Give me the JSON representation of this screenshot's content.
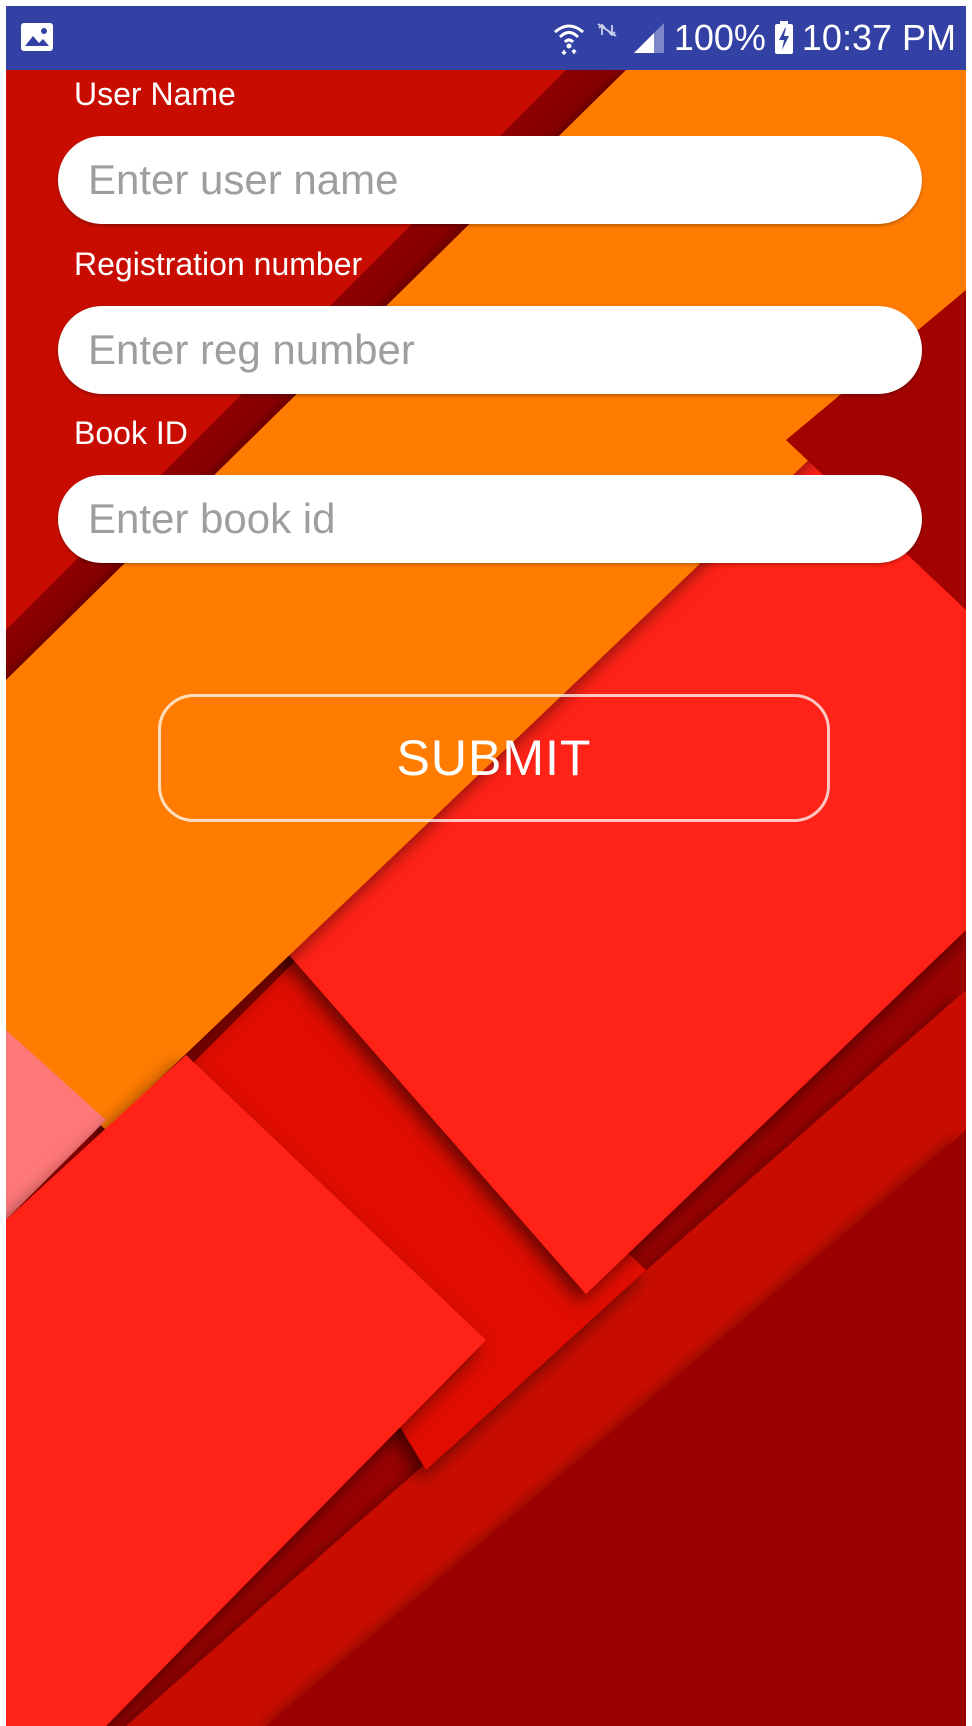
{
  "status_bar": {
    "left_icon": "image-icon",
    "icons": [
      "wifi-icon",
      "no-data-icon",
      "signal-icon",
      "battery-charging-icon"
    ],
    "battery": "100%",
    "time": "10:37 PM",
    "background": "#3241a3"
  },
  "form": {
    "username": {
      "label": "User Name",
      "placeholder": "Enter user name",
      "value": ""
    },
    "reg_number": {
      "label": "Registration number",
      "placeholder": "Enter reg number",
      "value": ""
    },
    "book_id": {
      "label": "Book ID",
      "placeholder": "Enter book id",
      "value": ""
    },
    "submit_label": "SUBMIT"
  },
  "colors": {
    "accent_orange": "#ff7b00",
    "red_primary": "#ff2219",
    "red_dark": "#9a0200",
    "red_mid": "#c80800",
    "pink": "#ff7878"
  }
}
